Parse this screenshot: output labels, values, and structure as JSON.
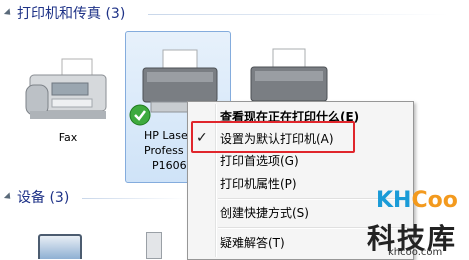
{
  "groups": {
    "printers": {
      "title": "打印机和传真 (3)"
    },
    "devices": {
      "title": "设备 (3)"
    }
  },
  "devices": {
    "fax": {
      "label": "Fax"
    },
    "hp": {
      "line1": "HP Lase",
      "line2": "Profess",
      "line3": "P1606"
    }
  },
  "context_menu": {
    "items": [
      {
        "label": "查看现在正在打印什么(E)",
        "bold": true
      },
      {
        "label": "设置为默认打印机(A)",
        "checked": true
      },
      {
        "label": "打印首选项(G)"
      },
      {
        "label": "打印机属性(P)"
      },
      {
        "label": "创建快捷方式(S)"
      },
      {
        "label": "疑难解答(T)"
      }
    ]
  },
  "watermark": {
    "logo_kh": "KH",
    "logo_coo": "Coo",
    "name": "科技库",
    "url": "khcoo.com"
  },
  "colors": {
    "group_title": "#1e3287",
    "highlight": "#e0262c",
    "logo_blue": "#1a9bd7",
    "logo_orange": "#f39a1e"
  }
}
